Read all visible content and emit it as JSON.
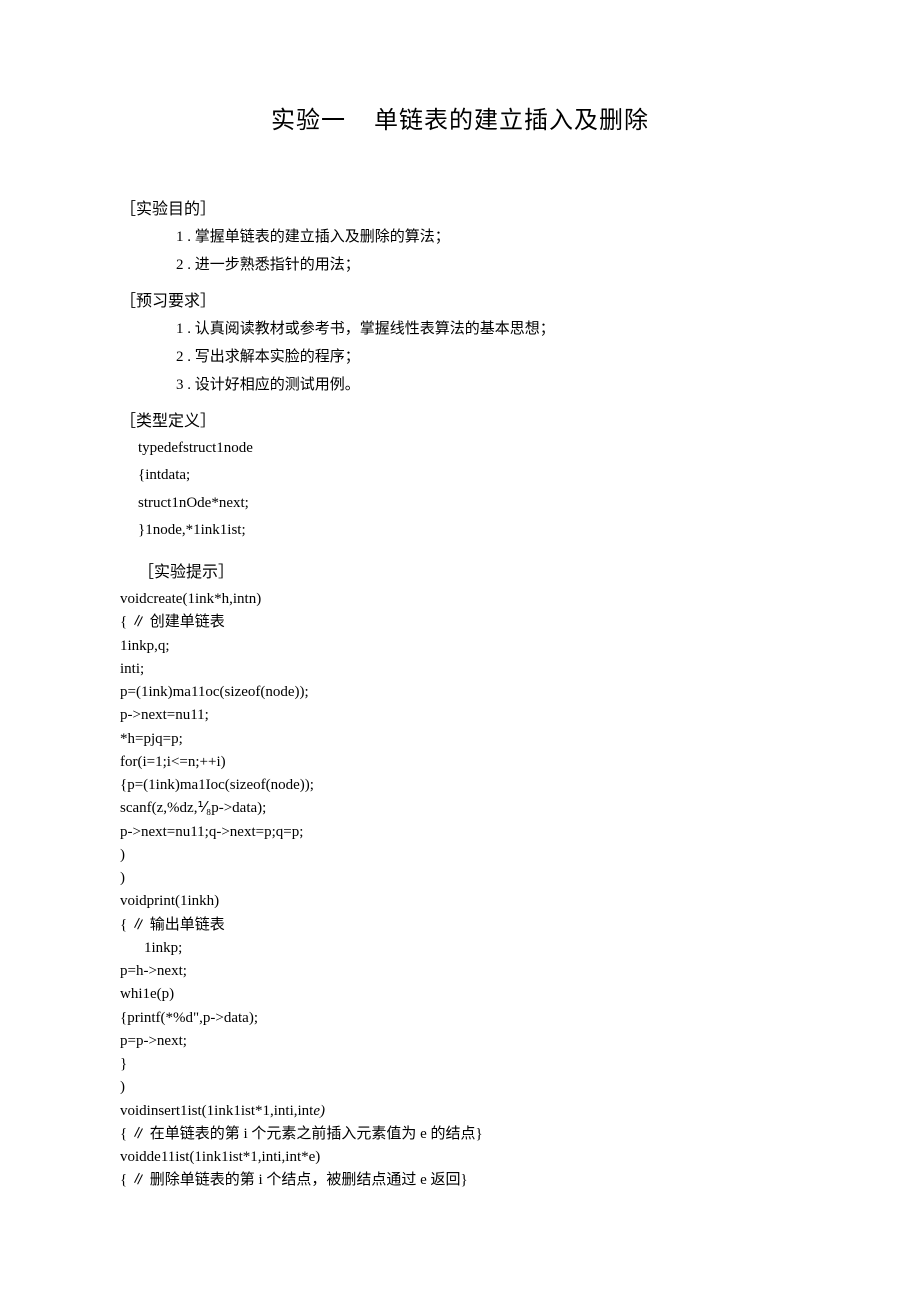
{
  "title_part1": "实验一",
  "title_part2": "单链表的建立插入及删除",
  "sections": {
    "purpose": {
      "header": "［实验目的］",
      "items": [
        "1  . 掌握单链表的建立插入及删除的算法；",
        "2  . 进一步熟悉指针的用法；"
      ]
    },
    "prep": {
      "header": "［预习要求］",
      "items": [
        "1  . 认真阅读教材或参考书，掌握线性表算法的基本思想；",
        "2  . 写出求解本实脸的程序；",
        "3  . 设计好相应的测试用例。"
      ]
    },
    "typedef": {
      "header": "［类型定义］",
      "lines": [
        "typedefstruct1node",
        "{intdata;",
        "struct1nOde*next;",
        "}1node,*1ink1ist;"
      ]
    },
    "hint": {
      "header": "［实验提示］",
      "lines": [
        "voidcreate(1ink*h,intn)",
        "{ ∥ 创建单链表",
        "1inkp,q;",
        "inti;",
        "p=(1ink)ma11oc(sizeof(node));",
        "p->next=nu11;",
        "*h=pjq=p;",
        "for(i=1;i<=n;++i)",
        "{p=(1ink)ma1Ioc(sizeof(node));",
        "scanf(z,%dz,⅟₈p->data);",
        "p->next=nu11;q->next=p;q=p;",
        ")",
        ")",
        "voidprint(1inkh)",
        "{ ∥ 输出单链表"
      ],
      "indented_line": "1inkp;",
      "lines2": [
        "p=h->next;",
        "whi1e(p)",
        "{printf(*%d\",p->data);",
        "p=p->next;",
        "}",
        ")"
      ],
      "insert_line_pre": "voidinsert1ist(1ink1ist*1,inti,int",
      "insert_line_italic": "e)",
      "insert_comment": "{ ∥ 在单链表的第 i 个元素之前插入元素值为 e 的结点}",
      "delete_line": "voidde11ist(1ink1ist*1,inti,int*e)",
      "delete_comment": "{ ∥ 删除单链表的第 i 个结点，被删结点通过 e 返回}"
    }
  }
}
